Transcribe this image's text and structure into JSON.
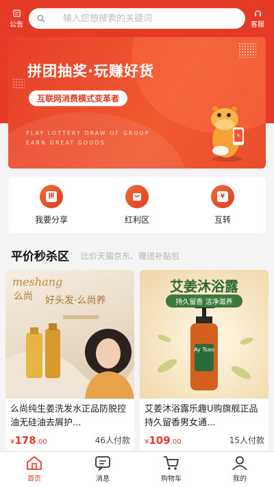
{
  "header": {
    "left_label": "公告",
    "right_label": "客服",
    "search_placeholder": "输入您想搜索的关键词"
  },
  "banner": {
    "title": "拼团抽奖·玩赚好货",
    "subtitle": "互联网消费模式变革者",
    "en_line1": "PLAY LOTTERY DRAW OF GROUP",
    "en_line2": "EARN GREAT GOODS"
  },
  "functions": [
    {
      "label": "我要分享",
      "icon": "share-icon",
      "glyph": "拼"
    },
    {
      "label": "红利区",
      "icon": "bag-icon",
      "glyph": ""
    },
    {
      "label": "互转",
      "icon": "yen-icon",
      "glyph": "¥"
    }
  ],
  "section": {
    "title": "平价秒杀区",
    "subtitle": "比价天猫京东、赠送补贴包"
  },
  "products": [
    {
      "name": "么尚纯生姜洗发水正品防脱控油无硅油去屑护...",
      "currency": "¥",
      "price_int": "178",
      "price_dec": ".00",
      "sold": "46人付款",
      "brand_en": "meshang",
      "brand_cn": "么尚",
      "slogan": "好头发·么尚养"
    },
    {
      "name": "艾姜沐浴露乐趣U购旗舰正品持久留香男女通...",
      "currency": "¥",
      "price_int": "109",
      "price_dec": ".00",
      "sold": "15人付款",
      "title": "艾姜沐浴露",
      "tagline": "持久留香 洁净滋养",
      "bottle_label": "Ay Tsao"
    }
  ],
  "tabbar": [
    {
      "label": "首页",
      "icon": "home-icon",
      "active": true
    },
    {
      "label": "消息",
      "icon": "message-icon",
      "active": false
    },
    {
      "label": "购物车",
      "icon": "cart-icon",
      "active": false
    },
    {
      "label": "我的",
      "icon": "user-icon",
      "active": false
    }
  ],
  "colors": {
    "brand": "#e53a26",
    "background": "#f4f4f4"
  }
}
